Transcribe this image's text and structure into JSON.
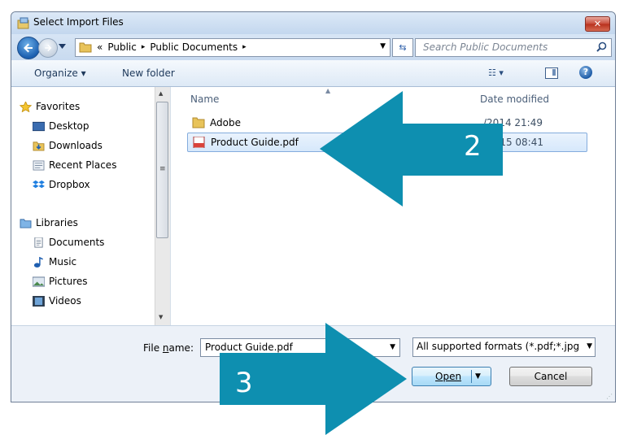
{
  "window": {
    "title": "Select Import Files",
    "close_label": "✕"
  },
  "address": {
    "crumbs": [
      "«",
      "Public",
      "▸",
      "Public Documents",
      "▸"
    ],
    "refresh_icon": "refresh-icon"
  },
  "search": {
    "placeholder": "Search Public Documents"
  },
  "toolbar": {
    "organize_label": "Organize ▾",
    "new_folder_label": "New folder",
    "view_label": "☷ ▾",
    "help_label": "?"
  },
  "nav": {
    "favorites_label": "Favorites",
    "favorites": [
      "Desktop",
      "Downloads",
      "Recent Places",
      "Dropbox"
    ],
    "libraries_label": "Libraries",
    "libraries": [
      "Documents",
      "Music",
      "Pictures",
      "Videos"
    ]
  },
  "files": {
    "columns": {
      "name": "Name",
      "date": "Date modified"
    },
    "rows": [
      {
        "name": "Adobe",
        "date": "/2014 21:49",
        "type": "folder",
        "selected": false
      },
      {
        "name": "Product Guide.pdf",
        "date": "/2015 08:41",
        "type": "pdf",
        "selected": true
      }
    ]
  },
  "bottom": {
    "file_name_label_pre": "File ",
    "file_name_label_u": "n",
    "file_name_label_post": "ame:",
    "file_name_value": "Product Guide.pdf",
    "file_type_value": "All supported formats (*.pdf;*.jpg",
    "open_label": "Open",
    "cancel_label": "Cancel"
  },
  "callouts": {
    "step2": "2",
    "step3": "3"
  },
  "colors": {
    "callout": "#0e8fb0",
    "accent": "#1b5fb0"
  }
}
